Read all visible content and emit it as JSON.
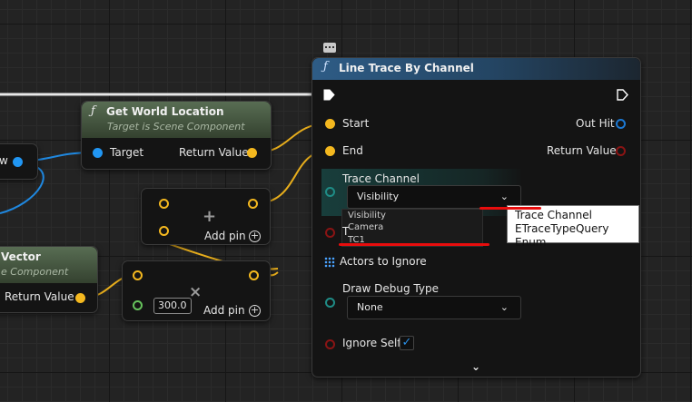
{
  "graph": {
    "nodes": {
      "get_world_location": {
        "title": "Get World Location",
        "subtitle": "Target is Scene Component",
        "pins": {
          "target": "Target",
          "return_value": "Return Value"
        }
      },
      "vector_node": {
        "title": "Vector",
        "subtitle": "e Component",
        "pins": {
          "return_value": "Return Value"
        }
      },
      "w_node": {
        "label": "w"
      },
      "add_node": {
        "add_pin": "Add pin"
      },
      "multiply_node": {
        "add_pin": "Add pin",
        "value": "300.0"
      },
      "line_trace": {
        "title": "Line Trace By Channel",
        "pins": {
          "start": "Start",
          "end": "End",
          "out_hit": "Out Hit",
          "return_value": "Return Value",
          "trace_channel": "Trace Channel",
          "actors_to_ignore": "Actors to Ignore",
          "draw_debug_type": "Draw Debug Type",
          "ignore_self": "Ignore Self"
        },
        "trace_channel_value": "Visibility",
        "trace_channel_options": [
          "Visibility",
          "Camera",
          "TC1"
        ],
        "draw_debug_value": "None",
        "second_pin_fragment": "T",
        "ignore_self_checked": true
      }
    },
    "tooltip": {
      "line1": "Trace Channel",
      "line2": "ETraceTypeQuery Enum"
    }
  },
  "icons": [
    "function-icon",
    "exec-pin-icon",
    "chevron-down-icon",
    "add-icon",
    "multiply-icon",
    "grid-array-icon",
    "comment-bubble-icon",
    "check-icon"
  ],
  "colors": {
    "vector_pin": "#f4b81f",
    "object_pin": "#2196f3",
    "enum_pin": "#1f8c86",
    "bool_pin": "#8a1414",
    "float_pin": "#66c35c",
    "highlight": "#e80d0d"
  }
}
